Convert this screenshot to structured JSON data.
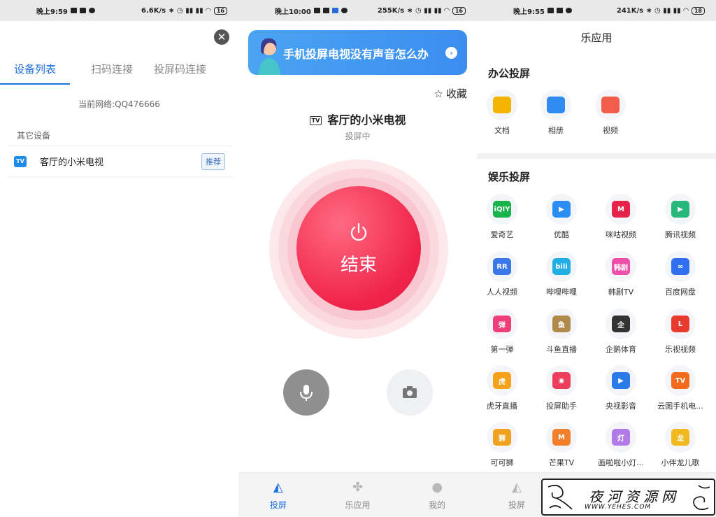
{
  "panel1": {
    "status": {
      "time": "晚上9:59",
      "speed": "6.6K/s",
      "battery": "16"
    },
    "tabs": [
      "设备列表",
      "扫码连接",
      "投屏码连接"
    ],
    "network": "当前网络:QQ476666",
    "section": "其它设备",
    "device": {
      "icon_text": "TV",
      "name": "客厅的小米电视",
      "badge": "推荐"
    }
  },
  "panel2": {
    "status": {
      "time": "晚上10:00",
      "speed": "255K/s",
      "battery": "16"
    },
    "banner": "手机投屏电视没有声音怎么办",
    "favorite": "收藏",
    "device_tv": "TV",
    "device_name": "客厅的小米电视",
    "state": "投屏中",
    "end_button": "结束",
    "accent": "#f0234a"
  },
  "panel3": {
    "status": {
      "time": "晚上9:55",
      "speed": "241K/s",
      "battery": "18"
    },
    "title": "乐应用",
    "office_title": "办公投屏",
    "office_apps": [
      {
        "label": "文档",
        "color": "#f5b400"
      },
      {
        "label": "相册",
        "color": "#2f8bf0"
      },
      {
        "label": "视频",
        "color": "#f25c4a"
      }
    ],
    "ent_title": "娱乐投屏",
    "ent_apps": [
      {
        "label": "爱奇艺",
        "logo": "iQIY",
        "color": "#18b34a"
      },
      {
        "label": "优酷",
        "logo": "▶",
        "color": "#2b8cf2"
      },
      {
        "label": "咪咕视频",
        "logo": "M",
        "color": "#e8234a"
      },
      {
        "label": "腾讯视频",
        "logo": "▶",
        "color": "#27b77a"
      },
      {
        "label": "人人视频",
        "logo": "RR",
        "color": "#3a78e8"
      },
      {
        "label": "哔哩哔哩",
        "logo": "bili",
        "color": "#23ade5"
      },
      {
        "label": "韩剧TV",
        "logo": "韩剧",
        "color": "#ef4fa8"
      },
      {
        "label": "百度网盘",
        "logo": "∞",
        "color": "#2f6ff0"
      },
      {
        "label": "第一弹",
        "logo": "弹",
        "color": "#ee3f79"
      },
      {
        "label": "斗鱼直播",
        "logo": "鱼",
        "color": "#b08a4a"
      },
      {
        "label": "企鹅体育",
        "logo": "企",
        "color": "#333333"
      },
      {
        "label": "乐视视频",
        "logo": "L",
        "color": "#e83a2f"
      },
      {
        "label": "虎牙直播",
        "logo": "虎",
        "color": "#f5a21b"
      },
      {
        "label": "投屏助手",
        "logo": "◉",
        "color": "#ee3d5c"
      },
      {
        "label": "央视影音",
        "logo": "▶",
        "color": "#2a7ae8"
      },
      {
        "label": "云图手机电...",
        "logo": "TV",
        "color": "#f36a1c"
      },
      {
        "label": "可可狮",
        "logo": "狮",
        "color": "#f0a21e"
      },
      {
        "label": "芒果TV",
        "logo": "M",
        "color": "#f2802a"
      },
      {
        "label": "画啦啦小灯...",
        "logo": "灯",
        "color": "#b07be8"
      },
      {
        "label": "小伴龙儿歌",
        "logo": "龙",
        "color": "#f2b81f"
      }
    ]
  },
  "nav": [
    "投屏",
    "乐应用",
    "我的"
  ],
  "watermark": {
    "title": "夜河资源网",
    "url": "WWW.YEHES.COM"
  }
}
